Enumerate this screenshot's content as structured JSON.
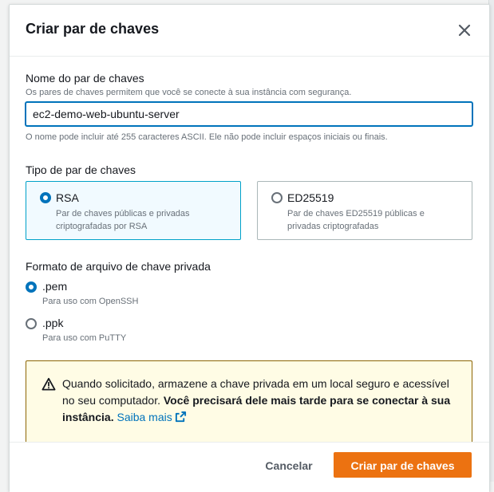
{
  "dialog": {
    "title": "Criar par de chaves",
    "close_icon": "close-icon"
  },
  "key_name": {
    "label": "Nome do par de chaves",
    "description": "Os pares de chaves permitem que você se conecte à sua instância com segurança.",
    "value": "ec2-demo-web-ubuntu-server",
    "constraint": "O nome pode incluir até 255 caracteres ASCII. Ele não pode incluir espaços iniciais ou finais."
  },
  "key_type": {
    "label": "Tipo de par de chaves",
    "options": [
      {
        "title": "RSA",
        "description": "Par de chaves públicas e privadas criptografadas por RSA",
        "selected": true
      },
      {
        "title": "ED25519",
        "description": "Par de chaves ED25519 públicas e privadas criptografadas",
        "selected": false
      }
    ]
  },
  "file_format": {
    "label": "Formato de arquivo de chave privada",
    "options": [
      {
        "title": ".pem",
        "description": "Para uso com OpenSSH",
        "selected": true
      },
      {
        "title": ".ppk",
        "description": "Para uso com PuTTY",
        "selected": false
      }
    ]
  },
  "alert": {
    "icon": "warning-icon",
    "text_plain": "Quando solicitado, armazene a chave privada em um local seguro e acessível no seu computador. ",
    "text_bold": "Você precisará dele mais tarde para se conectar à sua instância.",
    "link": "Saiba mais",
    "link_icon": "external-link-icon"
  },
  "footer": {
    "cancel_label": "Cancelar",
    "create_label": "Criar par de chaves"
  },
  "colors": {
    "primary": "#ec7211",
    "accent": "#0073bb",
    "warning_bg": "#fffce5",
    "warning_border": "#8d6605"
  }
}
